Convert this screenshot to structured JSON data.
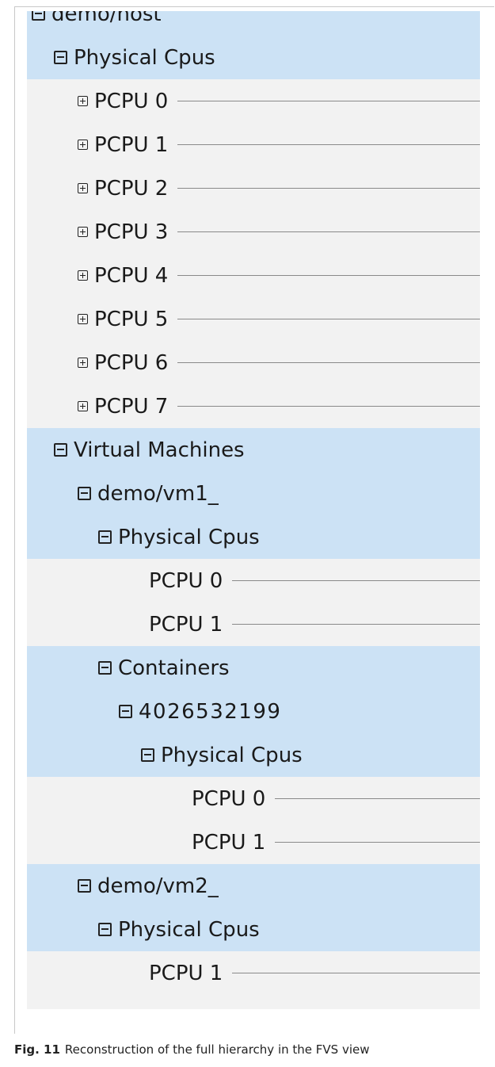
{
  "tree": {
    "root": "demo/host",
    "host_physical_cpus": "Physical Cpus",
    "host_pcpus": [
      "PCPU 0",
      "PCPU 1",
      "PCPU 2",
      "PCPU 3",
      "PCPU 4",
      "PCPU 5",
      "PCPU 6",
      "PCPU 7"
    ],
    "virtual_machines": "Virtual Machines",
    "vm1": "demo/vm1_",
    "vm1_physical_cpus": "Physical Cpus",
    "vm1_pcpus": [
      "PCPU 0",
      "PCPU 1"
    ],
    "containers": "Containers",
    "container_id": "4026532199",
    "container_physical_cpus": "Physical Cpus",
    "container_pcpus": [
      "PCPU 0",
      "PCPU 1"
    ],
    "vm2": "demo/vm2_",
    "vm2_physical_cpus": "Physical Cpus",
    "vm2_pcpus": [
      "PCPU 1"
    ]
  },
  "caption": {
    "figure": "Fig. 11",
    "text": "Reconstruction of the full hierarchy in the FVS view"
  },
  "colors": {
    "group_background": "#cce2f5",
    "leaf_background": "#f2f2f2"
  },
  "icons": {
    "expanded": "collapse-icon",
    "collapsed": "expand-icon"
  }
}
